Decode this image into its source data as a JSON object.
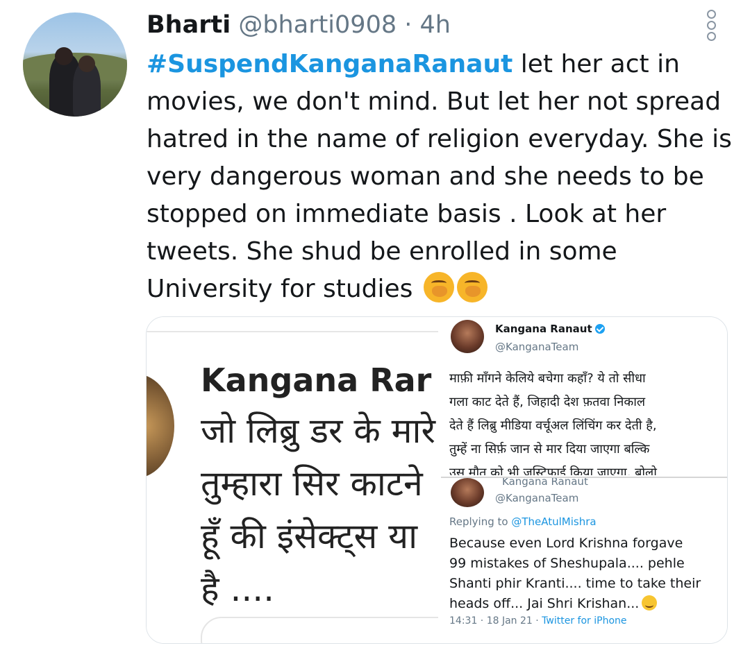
{
  "tweet": {
    "author_name": "Bharti",
    "author_handle": "@bharti0908",
    "separator": "·",
    "time": "4h",
    "hashtag": "#SuspendKanganaRanaut",
    "body": " let her act in\nmovies, we don't mind. But let her not spread\nhatred in the name of religion everyday. She is\nvery dangerous woman and she needs to be\nstopped on immediate basis . Look at her\ntweets. She shud be enrolled in some\nUniversity for studies",
    "emoji_icons": [
      "face-with-hand-over-mouth-icon",
      "face-with-hand-over-mouth-icon"
    ]
  },
  "media": {
    "left_image": {
      "name_text": "Kangana Rar",
      "line1": "जो लिब्रु डर के मारे",
      "line2": "तुम्हारा सिर काटने",
      "line3": "हूँ की इंसेक्ट्स या",
      "line4": "है ...."
    },
    "right_top": {
      "name": "Kangana Ranaut",
      "handle": "@KanganaTeam",
      "text": "माफ़ी माँगने केलिये बचेगा कहाँ? ये तो सीधा\nगला काट देते हैं, जिहादी देश फ़तवा निकाल\nदेते हैं लिब्रु मीडिया वर्चूअल लिंचिंग कर देती है,\nतुम्हें ना सिर्फ़ जान से मार दिया जाएगा बल्कि\nउस मौत को भी जस्टिफ़ाई किया जाएगा, बोलो"
    },
    "right_bottom": {
      "cut_name": "Kangana Ranaut",
      "handle": "@KanganaTeam",
      "replying_label": "Replying to",
      "reply_to": "@TheAtulMishra",
      "text": "Because even Lord Krishna forgave\n99 mistakes of Sheshupala.... pehle\nShanti phir Kranti.... time to take their\nheads off... Jai Shri Krishan...",
      "timestamp": "14:31 · 18 Jan 21 · ",
      "client": "Twitter for iPhone"
    }
  }
}
